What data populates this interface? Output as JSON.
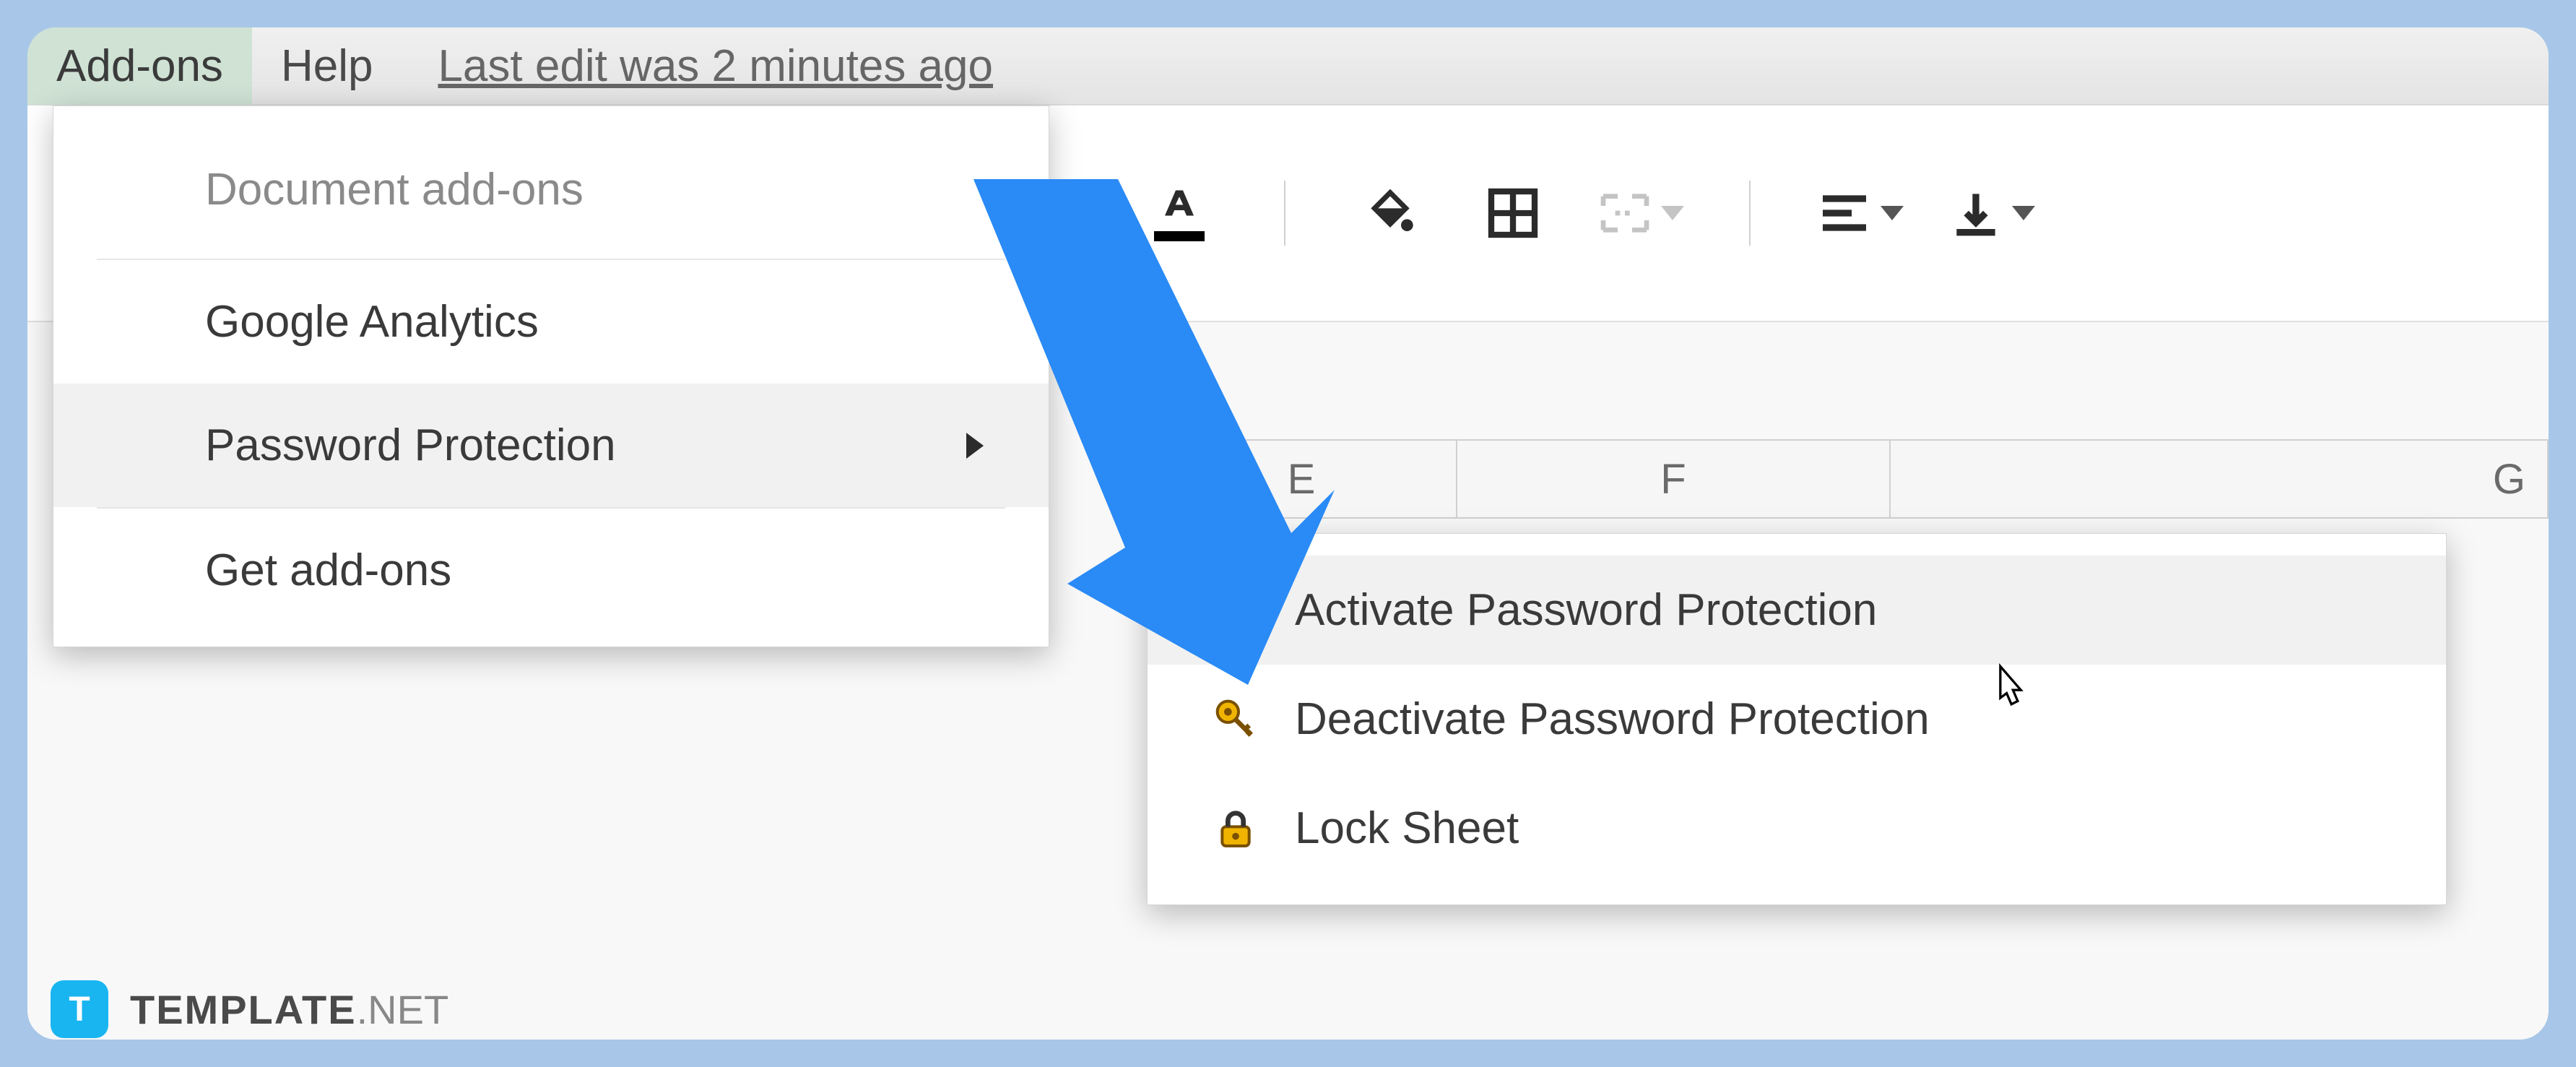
{
  "menubar": {
    "addons": "Add-ons",
    "help": "Help",
    "last_edit": "Last edit was 2 minutes ago"
  },
  "column_headers": {
    "e": "E",
    "f": "F",
    "g": "G"
  },
  "addons_menu": {
    "header": "Document add-ons",
    "items": [
      {
        "label": "Google Analytics"
      },
      {
        "label": "Password Protection"
      },
      {
        "label": "Get add-ons"
      }
    ]
  },
  "submenu": {
    "items": [
      {
        "label": "Activate Password Protection",
        "icon": "key"
      },
      {
        "label": "Deactivate Password Protection",
        "icon": "key"
      },
      {
        "label": "Lock Sheet",
        "icon": "lock"
      }
    ]
  },
  "watermark": {
    "brand": "TEMPLATE",
    "suffix": ".NET"
  }
}
